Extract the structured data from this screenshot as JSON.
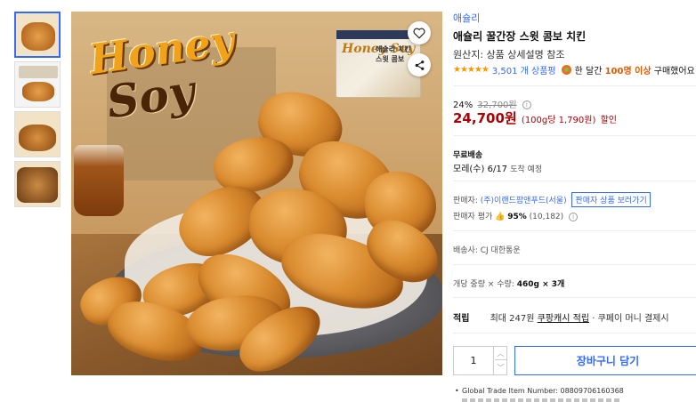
{
  "product": {
    "brand": "애슐리",
    "title": "애슐리 꿀간장 스윗 콤보 치킨",
    "origin": "원산지: 상품 상세설명 참조",
    "rating_stars": "★★★★★",
    "review_count": "3,501 개 상품평",
    "buyers_prefix": "한 달간",
    "buyers_highlight": "100명 이상",
    "buyers_suffix": "구매했어요"
  },
  "price": {
    "discount_rate": "24%",
    "original_price": "32,700원",
    "sale_price": "24,700원",
    "unit_price": "(100g당 1,790원)",
    "discount_label": "할인"
  },
  "shipping": {
    "title": "무료배송",
    "date": "모레(수) 6/17",
    "date_note": "도착 예정"
  },
  "seller": {
    "label": "판매자:",
    "name": "(주)이랜드팜앤푸드(서울)",
    "view_button": "판매자 상품 보러가기",
    "rating_label": "판매자 평가",
    "rating_pct": "95%",
    "rating_count": "(10,182)"
  },
  "delivery": {
    "carrier": "배송사: CJ 대한통운"
  },
  "spec": {
    "prefix": "개당 중량 × 수량:",
    "value": "460g × 3개"
  },
  "reward": {
    "label": "적립",
    "text": "최대 247원",
    "link": "쿠팡캐시 적립",
    "suffix": "· 쿠페이 머니 결제시"
  },
  "cart": {
    "quantity": "1",
    "add_to_cart": "장바구니 담기"
  },
  "details": {
    "gtin": "Global Trade Item Number: 08809706160368"
  },
  "image": {
    "logo_line1": "Honey",
    "logo_line2": "Soy",
    "pack_logo": "Honey Soy",
    "pack_text_1": "애슐리 치킨",
    "pack_text_2": "스윗 콤보"
  },
  "colors": {
    "accent_blue": "#346aff",
    "price_red": "#ae0000",
    "star_orange": "#ff9600"
  }
}
